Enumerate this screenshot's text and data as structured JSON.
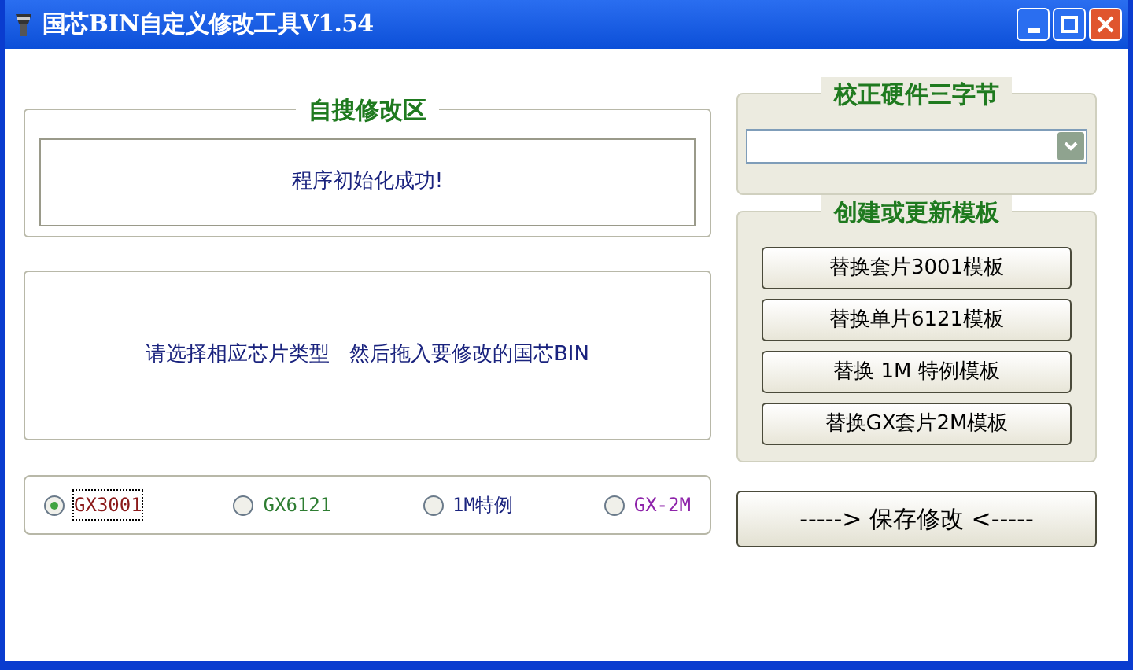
{
  "window": {
    "title": "国芯BIN自定义修改工具V1.54"
  },
  "search_section": {
    "title": "自搜修改区",
    "status": "程序初始化成功!"
  },
  "message_panel": {
    "text": "请选择相应芯片类型   然后拖入要修改的国芯BIN"
  },
  "chip_types": [
    {
      "label": "GX3001",
      "selected": true,
      "color": "#8b1a1a"
    },
    {
      "label": "GX6121",
      "selected": false,
      "color": "#2e7d32"
    },
    {
      "label": "1M特例",
      "selected": false,
      "color": "#1a237e"
    },
    {
      "label": "GX-2M",
      "selected": false,
      "color": "#8e24aa"
    }
  ],
  "hardware_section": {
    "title": "校正硬件三字节"
  },
  "template_section": {
    "title": "创建或更新模板",
    "buttons": [
      "替换套片3001模板",
      "替换单片6121模板",
      "替换 1M 特例模板",
      "替换GX套片2M模板"
    ]
  },
  "save_button": "-----> 保存修改 <-----"
}
